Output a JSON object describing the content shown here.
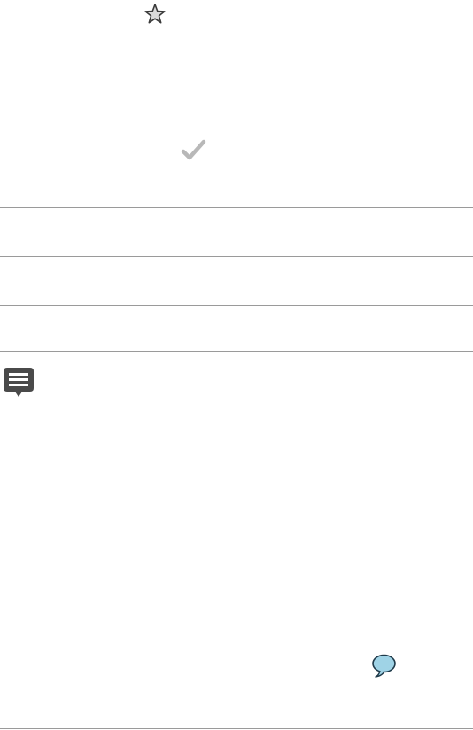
{
  "icons": {
    "favorite": "star-outline-icon",
    "confirm": "checkmark-icon",
    "menu": "menu-bubble-icon",
    "comment": "speech-bubble-icon"
  },
  "colors": {
    "background": "#ffffff",
    "divider": "#9a9a9a",
    "star_fill": "#d9d9d9",
    "star_stroke": "#3a3a3a",
    "check": "#b8b8b8",
    "menu_bubble": "#4a4a4a",
    "speech_bubble_fill": "#9fd3e6",
    "speech_bubble_stroke": "#1f3a4a"
  },
  "rows": [
    {
      "label": ""
    },
    {
      "label": ""
    },
    {
      "label": ""
    }
  ]
}
